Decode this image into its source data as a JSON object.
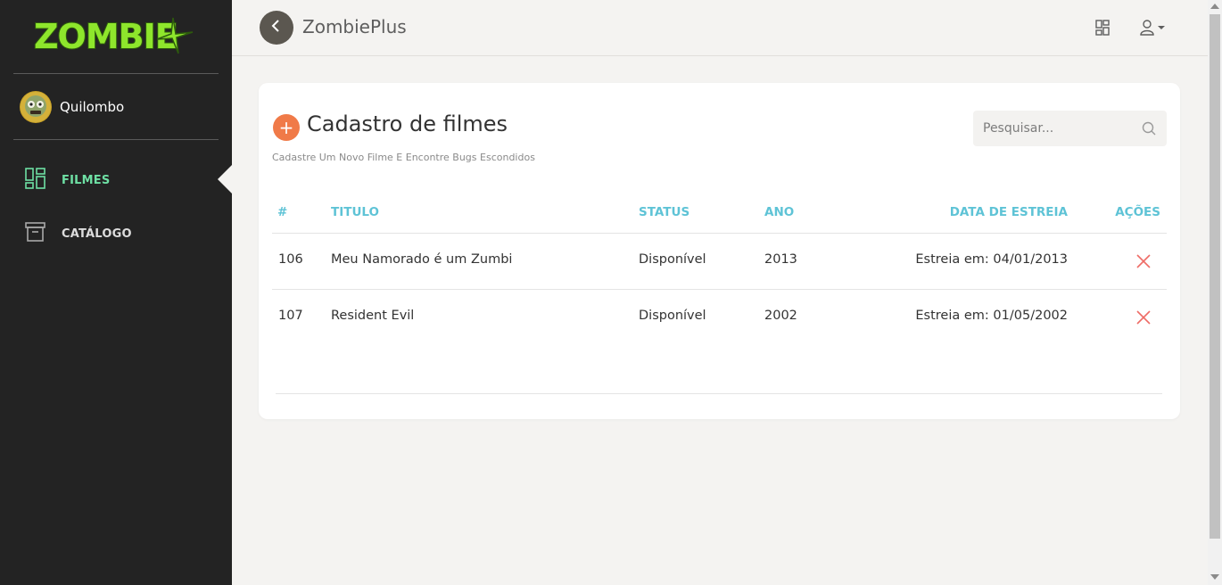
{
  "app": {
    "logo_text": "ZOMBIE+",
    "title": "ZombiePlus"
  },
  "user": {
    "name": "Quilombo"
  },
  "sidebar": {
    "items": [
      {
        "label": "FILMES",
        "icon": "dashboard-grid-icon",
        "active": true
      },
      {
        "label": "CATÁLOGO",
        "icon": "archive-box-icon",
        "active": false
      }
    ]
  },
  "topbar": {
    "icons": [
      "layout-grid-icon",
      "user-dropdown-icon"
    ]
  },
  "page": {
    "title": "Cadastro de filmes",
    "subtitle": "Cadastre Um Novo Filme E Encontre Bugs Escondidos",
    "add_icon": "+"
  },
  "search": {
    "placeholder": "Pesquisar..."
  },
  "table": {
    "headers": {
      "id": "#",
      "title": "TITULO",
      "status": "STATUS",
      "year": "ANO",
      "release": "DATA DE ESTREIA",
      "actions": "AÇÕES"
    },
    "rows": [
      {
        "id": "106",
        "title": "Meu Namorado é um Zumbi",
        "status": "Disponível",
        "year": "2013",
        "release": "Estreia em: 04/01/2013"
      },
      {
        "id": "107",
        "title": "Resident Evil",
        "status": "Disponível",
        "year": "2002",
        "release": "Estreia em: 01/05/2002"
      }
    ]
  },
  "colors": {
    "sidebar_bg": "#232323",
    "logo_green": "#8ee62c",
    "active_nav": "#6ee0a4",
    "header_teal": "#5ec3d6",
    "add_orange": "#f07a48",
    "delete_red": "#ee6c66",
    "page_bg": "#f4f3f1"
  }
}
